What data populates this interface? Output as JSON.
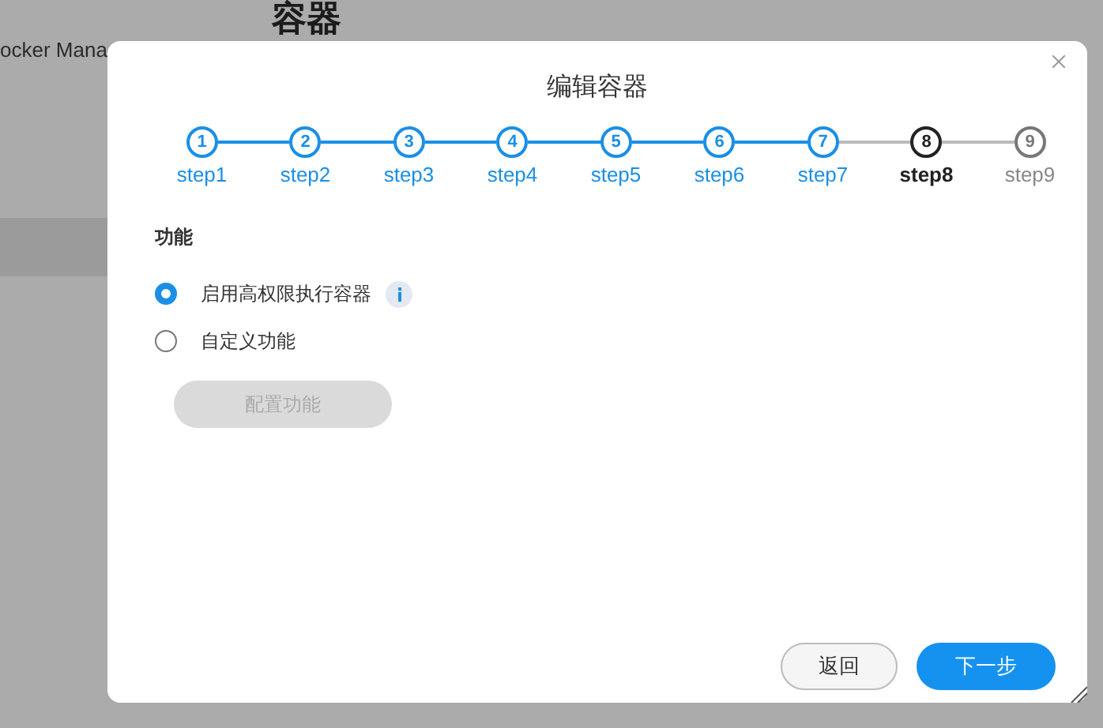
{
  "background": {
    "page_title": "容器",
    "app_name": "ocker Mana"
  },
  "dialog": {
    "title": "编辑容器",
    "steps": [
      {
        "number": "1",
        "label": "step1",
        "completed": true,
        "current": false
      },
      {
        "number": "2",
        "label": "step2",
        "completed": true,
        "current": false
      },
      {
        "number": "3",
        "label": "step3",
        "completed": true,
        "current": false
      },
      {
        "number": "4",
        "label": "step4",
        "completed": true,
        "current": false
      },
      {
        "number": "5",
        "label": "step5",
        "completed": true,
        "current": false
      },
      {
        "number": "6",
        "label": "step6",
        "completed": true,
        "current": false
      },
      {
        "number": "7",
        "label": "step7",
        "completed": true,
        "current": false
      },
      {
        "number": "8",
        "label": "step8",
        "completed": false,
        "current": true
      },
      {
        "number": "9",
        "label": "step9",
        "completed": false,
        "current": false
      }
    ],
    "section_title": "功能",
    "options": [
      {
        "label": "启用高权限执行容器",
        "selected": true,
        "info": true
      },
      {
        "label": "自定义功能",
        "selected": false,
        "info": false
      }
    ],
    "configure_button": {
      "label": "配置功能",
      "disabled": true
    },
    "buttons": [
      {
        "label": "返回",
        "kind": "secondary"
      },
      {
        "label": "下一步",
        "kind": "primary"
      }
    ]
  }
}
